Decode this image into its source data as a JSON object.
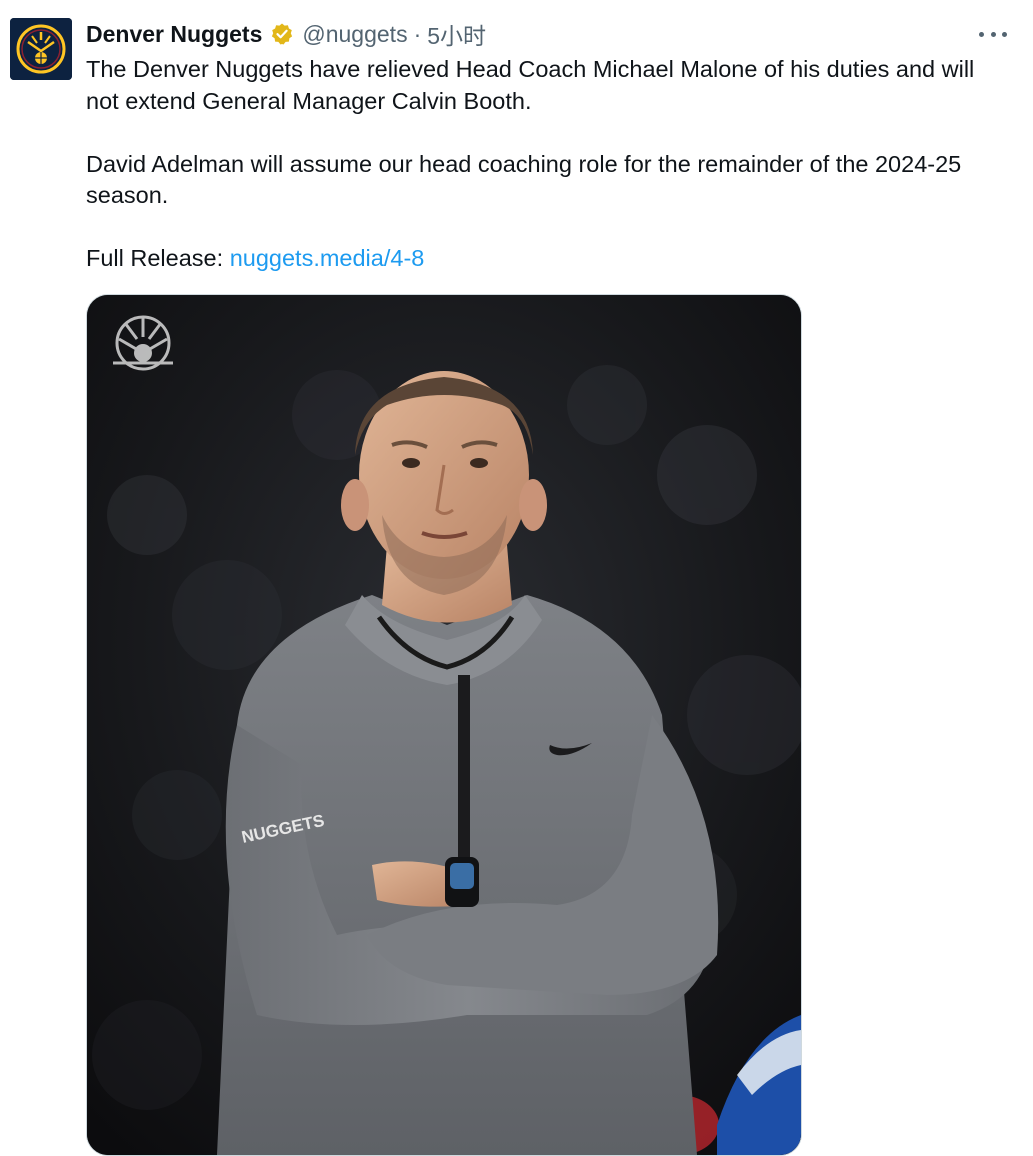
{
  "tweet": {
    "author_name": "Denver Nuggets",
    "handle": "@nuggets",
    "separator": "·",
    "time": "5小时",
    "paragraph1": "The Denver Nuggets have relieved Head Coach Michael Malone of his duties and will not extend General Manager Calvin Booth.",
    "paragraph2": "David Adelman will assume our head coaching role for the remainder of the 2024-25 season.",
    "release_label": "Full Release: ",
    "release_link": "nuggets.media/4-8",
    "jersey_text": "NUGGETS"
  },
  "icons": {
    "avatar": "nuggets-logo-icon",
    "verified": "verified-badge-icon",
    "more": "more-options-icon",
    "watermark": "nuggets-watermark-icon"
  },
  "colors": {
    "link": "#1d9bf0",
    "verified_gold": "#e2b719",
    "text": "#0f1419",
    "muted": "#536471",
    "avatar_bg": "#0d2240"
  }
}
